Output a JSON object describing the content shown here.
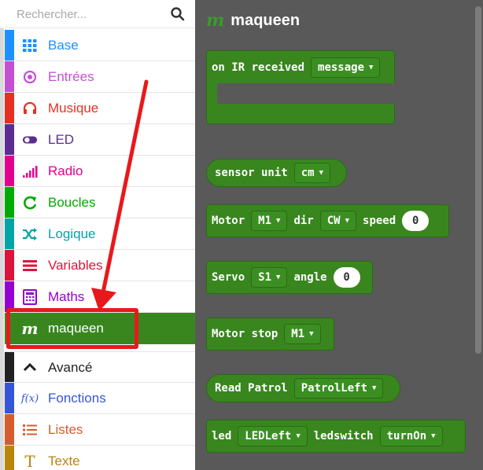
{
  "search": {
    "placeholder": "Rechercher..."
  },
  "categories": [
    {
      "label": "Base",
      "color": "#1e90ff",
      "icon": "grid-icon"
    },
    {
      "label": "Entrées",
      "color": "#c44fd6",
      "icon": "radio-button-icon"
    },
    {
      "label": "Musique",
      "color": "#e63022",
      "icon": "headphones-icon"
    },
    {
      "label": "LED",
      "color": "#5c2d91",
      "icon": "toggle-icon"
    },
    {
      "label": "Radio",
      "color": "#e3008c",
      "icon": "signal-bars-icon"
    },
    {
      "label": "Boucles",
      "color": "#00aa00",
      "icon": "refresh-icon"
    },
    {
      "label": "Logique",
      "color": "#00a4a6",
      "icon": "shuffle-icon"
    },
    {
      "label": "Variables",
      "color": "#dc143c",
      "icon": "lines-icon"
    },
    {
      "label": "Maths",
      "color": "#9400d3",
      "icon": "calculator-icon"
    },
    {
      "label": "maqueen",
      "color": "#39861f",
      "icon": "maqueen-m-icon",
      "selected": true
    },
    {
      "label": "Avancé",
      "color": "#222222",
      "icon": "chevron-up-icon"
    },
    {
      "label": "Fonctions",
      "color": "#3455db",
      "icon": "function-icon"
    },
    {
      "label": "Listes",
      "color": "#d65cd6",
      "icon": "list-icon"
    },
    {
      "label": "Texte",
      "color": "#b8860b",
      "icon": "text-icon"
    }
  ],
  "flyout": {
    "title": "maqueen",
    "title_glyph": "m",
    "blocks": {
      "ir": {
        "text": "on IR received",
        "dd": "message"
      },
      "sensor": {
        "text": "sensor unit",
        "dd": "cm"
      },
      "motor": {
        "t1": "Motor",
        "dd1": "M1",
        "t2": "dir",
        "dd2": "CW",
        "t3": "speed",
        "num": "0"
      },
      "servo": {
        "t1": "Servo",
        "dd1": "S1",
        "t2": "angle",
        "num": "0"
      },
      "motorstop": {
        "t1": "Motor stop",
        "dd1": "M1"
      },
      "patrol": {
        "t1": "Read Patrol",
        "dd1": "PatrolLeft"
      },
      "led": {
        "t1": "led",
        "dd1": "LEDLeft",
        "t2": "ledswitch",
        "dd2": "turnOn"
      }
    }
  },
  "colors": {
    "flyout_bg": "#595959",
    "block_green": "#39861f",
    "annotation_red": "#e8191c"
  }
}
